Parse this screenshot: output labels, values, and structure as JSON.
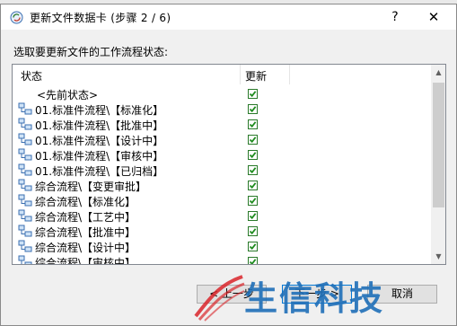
{
  "dialog": {
    "title": "更新文件数据卡 (步骤 2 / 6)",
    "help_label": "?",
    "close_label": "✕",
    "prompt": "选取要更新文件的工作流程状态:"
  },
  "table": {
    "headers": {
      "state": "状态",
      "update": "更新"
    },
    "rows": [
      {
        "label": "<先前状态>",
        "has_icon": false,
        "checked": true
      },
      {
        "label": "01.标准件流程\\【标准化】",
        "has_icon": true,
        "checked": true
      },
      {
        "label": "01.标准件流程\\【批准中】",
        "has_icon": true,
        "checked": true
      },
      {
        "label": "01.标准件流程\\【设计中】",
        "has_icon": true,
        "checked": true
      },
      {
        "label": "01.标准件流程\\【审核中】",
        "has_icon": true,
        "checked": true
      },
      {
        "label": "01.标准件流程\\【已归档】",
        "has_icon": true,
        "checked": true
      },
      {
        "label": "综合流程\\【变更审批】",
        "has_icon": true,
        "checked": true
      },
      {
        "label": "综合流程\\【标准化】",
        "has_icon": true,
        "checked": true
      },
      {
        "label": "综合流程\\【工艺中】",
        "has_icon": true,
        "checked": true
      },
      {
        "label": "综合流程\\【批准中】",
        "has_icon": true,
        "checked": true
      },
      {
        "label": "综合流程\\【设计中】",
        "has_icon": true,
        "checked": true
      },
      {
        "label": "综合流程\\【审核中】",
        "has_icon": true,
        "checked": true
      }
    ]
  },
  "buttons": {
    "prev": "< 上一步",
    "next": "下一步 >",
    "cancel": "取消"
  },
  "watermark": {
    "text": "生信科技"
  },
  "colors": {
    "accent": "#0078d7",
    "check": "#1e8c1e",
    "watermark_red": "#d9252a",
    "watermark_blue": "#1f6fb8"
  },
  "icons": {
    "app": "refresh-card-icon",
    "row": "workflow-state-icon",
    "check": "checkbox-checked-icon"
  }
}
